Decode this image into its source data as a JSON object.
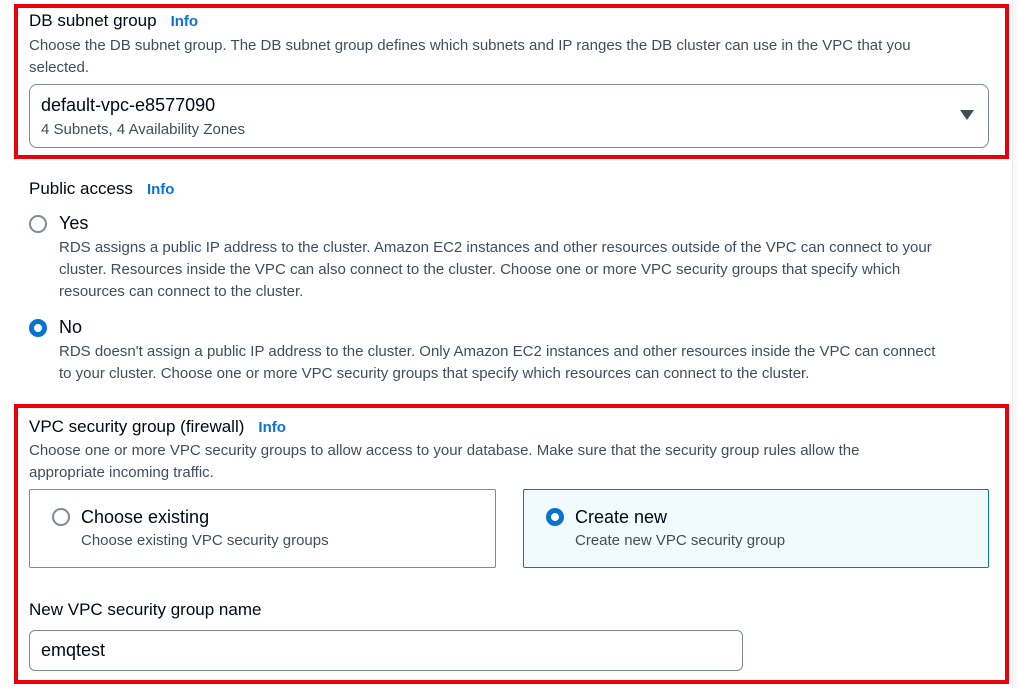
{
  "db_subnet_group": {
    "label": "DB subnet group",
    "info": "Info",
    "description_line1": "Choose the DB subnet group. The DB subnet group defines which subnets and IP ranges the DB cluster can use in the VPC that you",
    "description_line2": "selected.",
    "selected_value": "default-vpc-e8577090",
    "selected_detail": "4 Subnets, 4 Availability Zones"
  },
  "public_access": {
    "label": "Public access",
    "info": "Info",
    "options": [
      {
        "label": "Yes",
        "checked": false,
        "description_lines": [
          "RDS assigns a public IP address to the cluster. Amazon EC2 instances and other resources outside of the VPC can connect to your",
          "cluster. Resources inside the VPC can also connect to the cluster. Choose one or more VPC security groups that specify which",
          "resources can connect to the cluster."
        ]
      },
      {
        "label": "No",
        "checked": true,
        "description_lines": [
          "RDS doesn't assign a public IP address to the cluster. Only Amazon EC2 instances and other resources inside the VPC can connect",
          "to your cluster. Choose one or more VPC security groups that specify which resources can connect to the cluster."
        ]
      }
    ]
  },
  "vpc_security_group": {
    "label": "VPC security group (firewall)",
    "info": "Info",
    "description_line1": "Choose one or more VPC security groups to allow access to your database. Make sure that the security group rules allow the",
    "description_line2": "appropriate incoming traffic.",
    "tiles": [
      {
        "title": "Choose existing",
        "subtitle": "Choose existing VPC security groups",
        "selected": false
      },
      {
        "title": "Create new",
        "subtitle": "Create new VPC security group",
        "selected": true
      }
    ],
    "new_name_label": "New VPC security group name",
    "new_name_value": "emqtest"
  },
  "colors": {
    "highlight": "#e8000b",
    "accent": "#0972d3",
    "selected_tile_bg": "#f1faff"
  }
}
